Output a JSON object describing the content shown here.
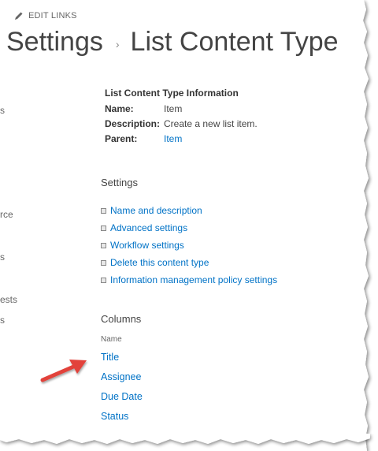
{
  "edit_links": {
    "label": "EDIT LINKS",
    "icon": "pencil-icon"
  },
  "breadcrumb": {
    "parent": "Settings",
    "separator": "›",
    "current": "List Content Type"
  },
  "left_nav_fragments": [
    "s",
    "rce",
    "s",
    "ests",
    "s"
  ],
  "info": {
    "heading": "List Content Type Information",
    "name_label": "Name:",
    "name_value": "Item",
    "description_label": "Description:",
    "description_value": "Create a new list item.",
    "parent_label": "Parent:",
    "parent_value": "Item"
  },
  "settings": {
    "title": "Settings",
    "items": [
      "Name and description",
      "Advanced settings",
      "Workflow settings",
      "Delete this content type",
      "Information management policy settings"
    ]
  },
  "columns": {
    "title": "Columns",
    "header": "Name",
    "items": [
      "Title",
      "Assignee",
      "Due Date",
      "Status"
    ]
  },
  "colors": {
    "link": "#0072c6",
    "text": "#444444",
    "arrow": "#e2433b"
  }
}
